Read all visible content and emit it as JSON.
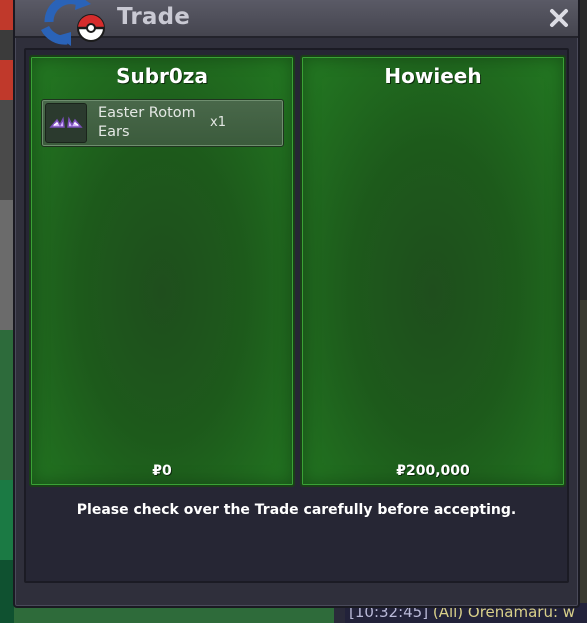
{
  "window": {
    "title": "Trade",
    "close_icon": "close-icon",
    "logo_icon": "trade-swap-pokeball-icon"
  },
  "trade": {
    "left": {
      "player": "Subr0za",
      "items": [
        {
          "name": "Easter Rotom Ears",
          "qty": "x1",
          "icon": "rotom-ears-icon"
        }
      ],
      "money": "₽0"
    },
    "right": {
      "player": "Howieeh",
      "items": [],
      "money": "₽200,000"
    },
    "notice": "Please check over the Trade carefully before accepting."
  },
  "background": {
    "chat_timestamp": "[10:32:45]",
    "chat_text": " (All) Orenamaru: w"
  },
  "colors": {
    "panel_green": "#237a22",
    "window_bg": "#2f2f3b",
    "title_text": "#c9c9d3"
  }
}
